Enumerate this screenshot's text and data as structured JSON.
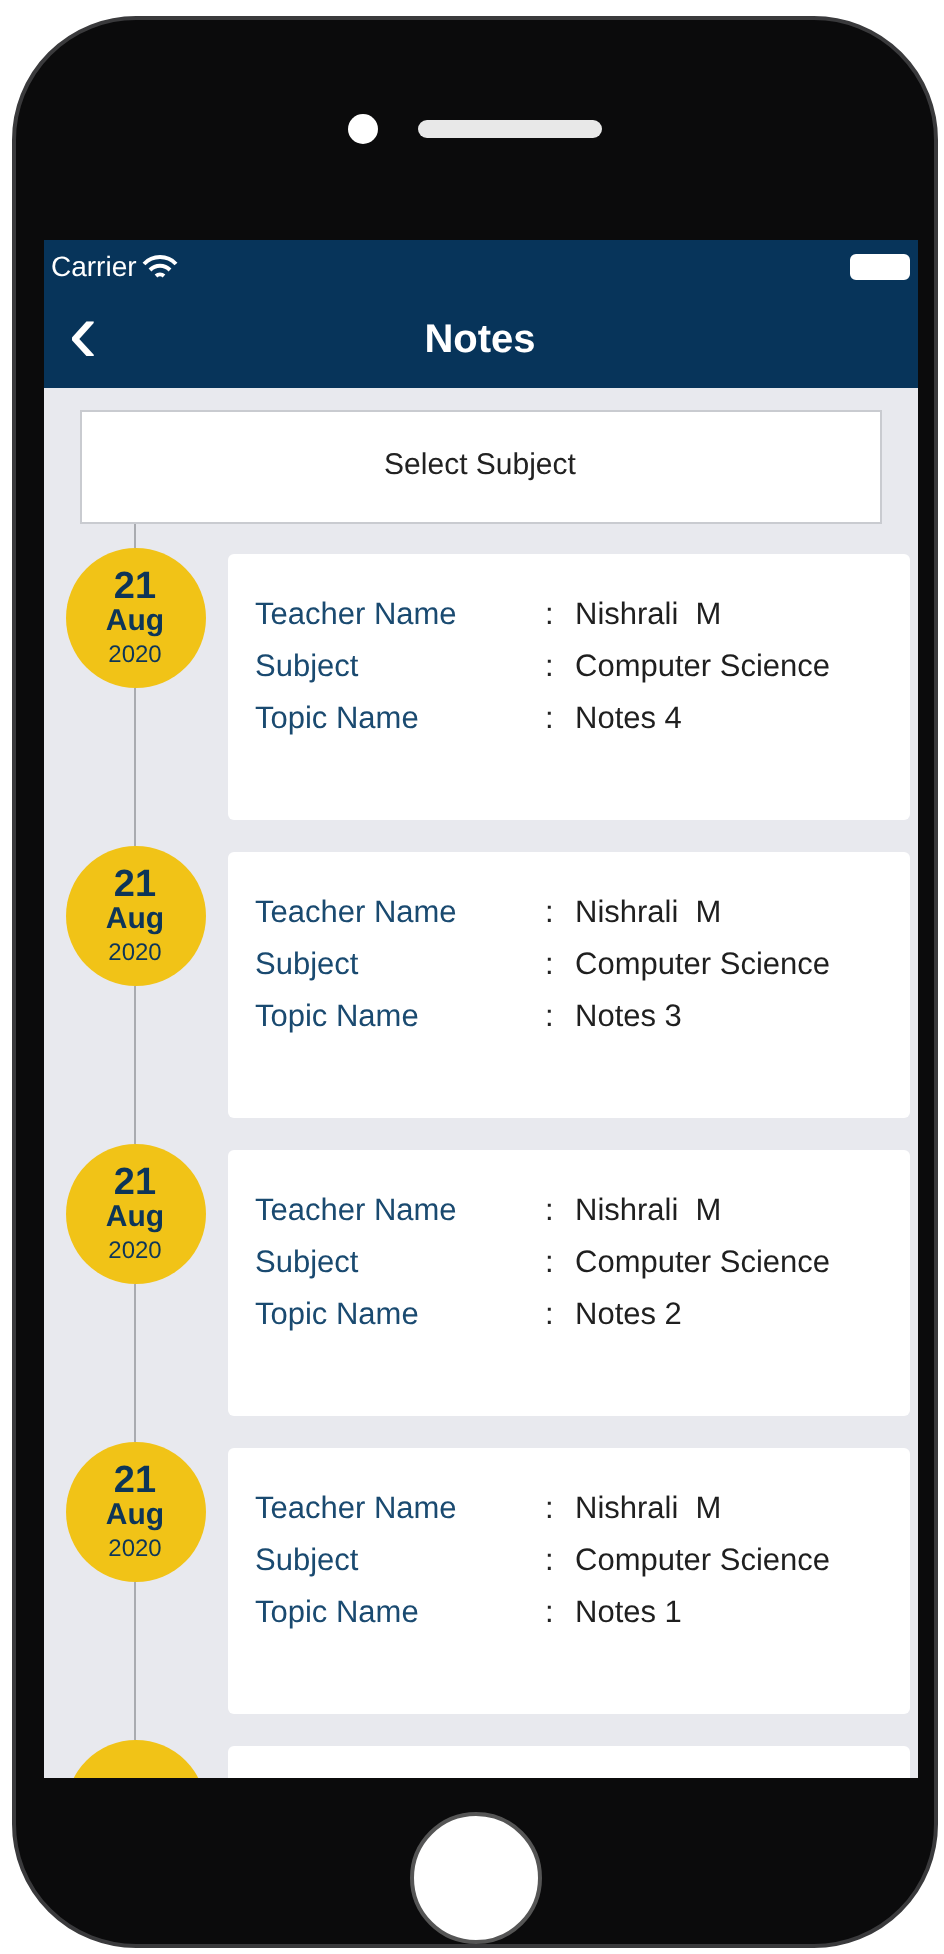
{
  "status_bar": {
    "carrier": "Carrier"
  },
  "nav": {
    "back": "‹",
    "title": "Notes"
  },
  "subject_picker": {
    "label": "Select Subject"
  },
  "entries": [
    {
      "day": "21",
      "month": "Aug",
      "year": "2020",
      "fields": [
        {
          "label": "Teacher Name",
          "sep": ":",
          "value": "Nishrali  M"
        },
        {
          "label": "Subject",
          "sep": ":",
          "value": "Computer Science"
        },
        {
          "label": "Topic Name",
          "sep": ":",
          "value": "Notes 4"
        }
      ]
    },
    {
      "day": "21",
      "month": "Aug",
      "year": "2020",
      "fields": [
        {
          "label": "Teacher Name",
          "sep": ":",
          "value": "Nishrali  M"
        },
        {
          "label": "Subject",
          "sep": ":",
          "value": "Computer Science"
        },
        {
          "label": "Topic Name",
          "sep": ":",
          "value": "Notes 3"
        }
      ]
    },
    {
      "day": "21",
      "month": "Aug",
      "year": "2020",
      "fields": [
        {
          "label": "Teacher Name",
          "sep": ":",
          "value": "Nishrali  M"
        },
        {
          "label": "Subject",
          "sep": ":",
          "value": "Computer Science"
        },
        {
          "label": "Topic Name",
          "sep": ":",
          "value": "Notes 2"
        }
      ]
    },
    {
      "day": "21",
      "month": "Aug",
      "year": "2020",
      "fields": [
        {
          "label": "Teacher Name",
          "sep": ":",
          "value": "Nishrali  M"
        },
        {
          "label": "Subject",
          "sep": ":",
          "value": "Computer Science"
        },
        {
          "label": "Topic Name",
          "sep": ":",
          "value": "Notes 1"
        }
      ]
    }
  ],
  "partial_next_entry": true
}
